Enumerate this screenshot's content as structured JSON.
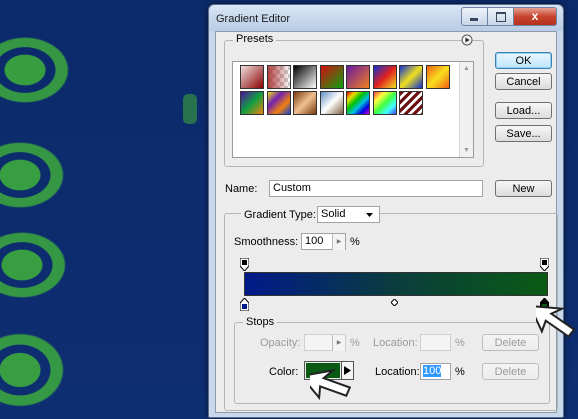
{
  "window": {
    "title": "Gradient Editor",
    "controls": [
      "minimize",
      "maximize",
      "close"
    ],
    "close_glyph": "x"
  },
  "presets": {
    "label": "Presets",
    "menu_icon": "triangle-right-circle-icon",
    "row1": [
      {
        "name": "foreground-to-background",
        "colors": [
          "#f0e0e0",
          "#8a0000"
        ]
      },
      {
        "name": "foreground-to-transparent",
        "colors": [
          "#b04040",
          "#eeeeee"
        ]
      },
      {
        "name": "black-white",
        "colors": [
          "#000000",
          "#ffffff"
        ]
      },
      {
        "name": "red-green",
        "colors": [
          "#d01010",
          "#10a010"
        ]
      },
      {
        "name": "violet-orange",
        "colors": [
          "#6a1aa0",
          "#f08020"
        ]
      },
      {
        "name": "blue-red-yellow",
        "colors": [
          "#1030d0",
          "#e02020",
          "#f0e020"
        ]
      },
      {
        "name": "blue-yellow-blue",
        "colors": [
          "#1030d0",
          "#f0e020",
          "#1030d0"
        ]
      },
      {
        "name": "orange-yellow-orange",
        "colors": [
          "#f06010",
          "#f8e020",
          "#f06010"
        ]
      }
    ],
    "row2": [
      {
        "name": "violet-green-orange",
        "colors": [
          "#5010a0",
          "#10a040",
          "#f08010"
        ]
      },
      {
        "name": "yellow-violet-orange-blue",
        "colors": [
          "#f0e020",
          "#7020b0",
          "#f08010",
          "#1040d0"
        ]
      },
      {
        "name": "copper",
        "colors": [
          "#7a3a10",
          "#f0c090",
          "#7a3a10"
        ]
      },
      {
        "name": "chrome",
        "colors": [
          "#6090c0",
          "#ffffff",
          "#806040"
        ]
      },
      {
        "name": "spectrum",
        "colors": [
          "#e00000",
          "#f0e000",
          "#00c000",
          "#00c0e0",
          "#0000e0",
          "#e000e0"
        ]
      },
      {
        "name": "transparent-rainbow",
        "colors": [
          "#ff4040",
          "#ffff40",
          "#40ff40",
          "#40ffff",
          "#4040ff"
        ]
      },
      {
        "name": "transparent-stripes",
        "colors": [
          "#6a1010",
          "#ffffff"
        ]
      }
    ]
  },
  "buttons": {
    "ok": "OK",
    "cancel": "Cancel",
    "load": "Load...",
    "save": "Save...",
    "new": "New"
  },
  "name": {
    "label": "Name:",
    "value": "Custom"
  },
  "gradient": {
    "type_label": "Gradient Type:",
    "type_value": "Solid",
    "smoothness_label": "Smoothness:",
    "smoothness_value": "100",
    "smoothness_unit": "%",
    "start_color": "#001a8a",
    "end_color": "#0b5a14"
  },
  "stops": {
    "label": "Stops",
    "opacity_label": "Opacity:",
    "opacity_value": "",
    "opacity_unit": "%",
    "opacity_location_label": "Location:",
    "opacity_location_value": "",
    "opacity_location_unit": "%",
    "delete_label": "Delete",
    "color_label": "Color:",
    "color_value": "#0b5a14",
    "color_location_label": "Location:",
    "color_location_value": "100",
    "color_location_unit": "%"
  },
  "colors": {
    "accent": "#3c7fb1",
    "selection": "#3399ff"
  }
}
